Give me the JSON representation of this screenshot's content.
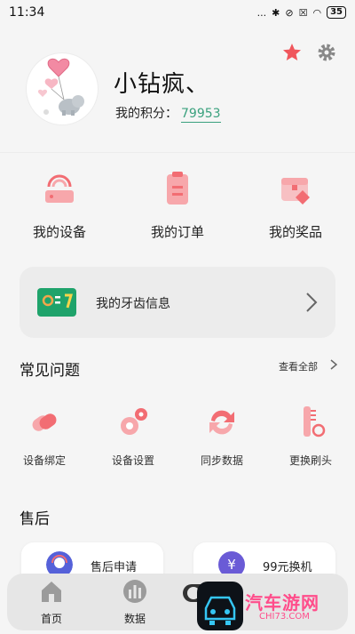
{
  "status_bar": {
    "time": "11:34",
    "dots": "...",
    "battery": "35"
  },
  "profile": {
    "name": "小钻疯、",
    "points_label": "我的积分：",
    "points_value": "79953"
  },
  "quick_actions": [
    {
      "label": "我的设备",
      "icon": "router-icon"
    },
    {
      "label": "我的订单",
      "icon": "clipboard-icon"
    },
    {
      "label": "我的奖品",
      "icon": "prize-box-icon"
    }
  ],
  "teeth_info": {
    "label": "我的牙齿信息",
    "icon": "teeth-chart-icon"
  },
  "faq": {
    "title": "常见问题",
    "view_all": "查看全部",
    "items": [
      {
        "label": "设备绑定",
        "icon": "bind-icon"
      },
      {
        "label": "设备设置",
        "icon": "settings-gears-icon"
      },
      {
        "label": "同步数据",
        "icon": "sync-icon"
      },
      {
        "label": "更换刷头",
        "icon": "brush-head-icon"
      }
    ]
  },
  "after_sales": {
    "title": "售后",
    "cards": [
      {
        "label": "售后申请",
        "icon": "headset-agent-icon"
      },
      {
        "label": "99元换机",
        "icon": "yuan-coin-icon",
        "icon_text": "¥"
      }
    ]
  },
  "bottom_nav": [
    {
      "label": "首页",
      "icon": "home-icon"
    },
    {
      "label": "数据",
      "icon": "bar-chart-icon"
    }
  ],
  "overlay": {
    "brand": "汽车游网",
    "sub": "CHI73.COM"
  },
  "colors": {
    "accent_red": "#f26d73",
    "points_green": "#3aa17e",
    "card_gray": "#ececec"
  }
}
